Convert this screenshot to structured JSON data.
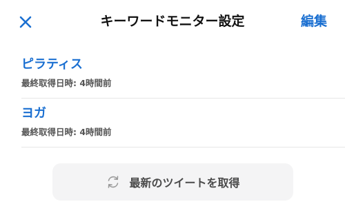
{
  "header": {
    "title": "キーワードモニター設定",
    "edit_label": "編集",
    "close_icon": "close-icon",
    "accent_color": "#1a6fd1"
  },
  "keywords": [
    {
      "name": "ピラティス",
      "last_fetched": "最終取得日時: 4時間前"
    },
    {
      "name": "ヨガ",
      "last_fetched": "最終取得日時: 4時間前"
    }
  ],
  "fetch_button": {
    "label": "最新のツイートを取得",
    "icon": "refresh-icon"
  }
}
